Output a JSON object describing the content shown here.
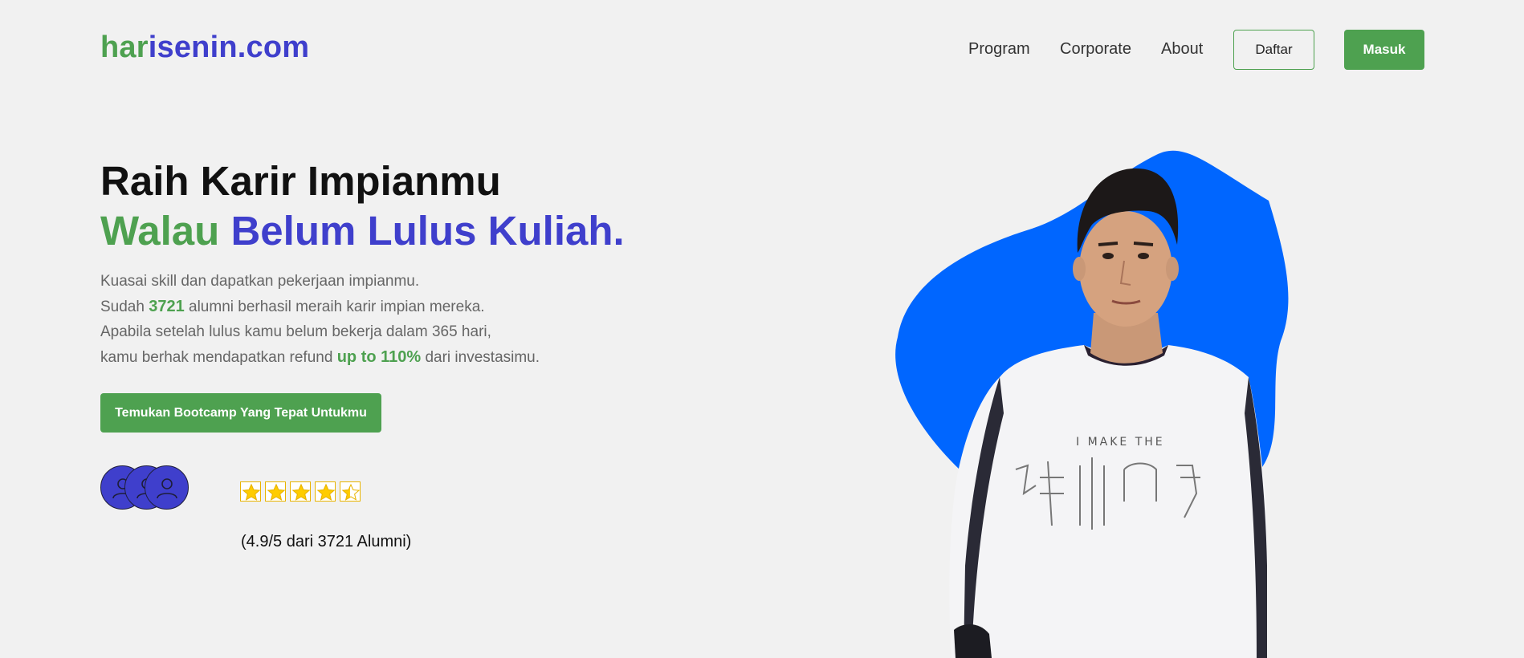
{
  "brand": {
    "part1": "har",
    "part2": "isenin",
    "part3": ".com"
  },
  "nav": {
    "links": [
      "Program",
      "Corporate",
      "About"
    ],
    "daftar_label": "Daftar",
    "masuk_label": "Masuk"
  },
  "hero": {
    "headline_line1": "Raih Karir Impianmu",
    "headline_line2_green": "Walau",
    "headline_line2_blue": "Belum Lulus Kuliah.",
    "para1": "Kuasai skill dan dapatkan pekerjaan impianmu.",
    "para2_pre": "Sudah",
    "para2_num": "3721",
    "para2_post": "alumni berhasil meraih karir impian mereka.",
    "para3": "Apabila setelah lulus kamu belum bekerja dalam 365 hari,",
    "para4_pre": "kamu berhak mendapatkan refund",
    "para4_highlight": "up to 110%",
    "para4_post": "dari investasimu.",
    "cta_label": "Temukan Bootcamp Yang Tepat Untukmu"
  },
  "social_proof": {
    "avatar_count": 3,
    "rating": 4.5,
    "rating_max": 5,
    "rating_text": "(4.9/5 dari 3721 Alumni)"
  },
  "colors": {
    "green": "#4ea150",
    "blue": "#3f3fcc",
    "blob": "#0066ff",
    "star": "#ffcc00",
    "background": "#f1f1f1"
  }
}
